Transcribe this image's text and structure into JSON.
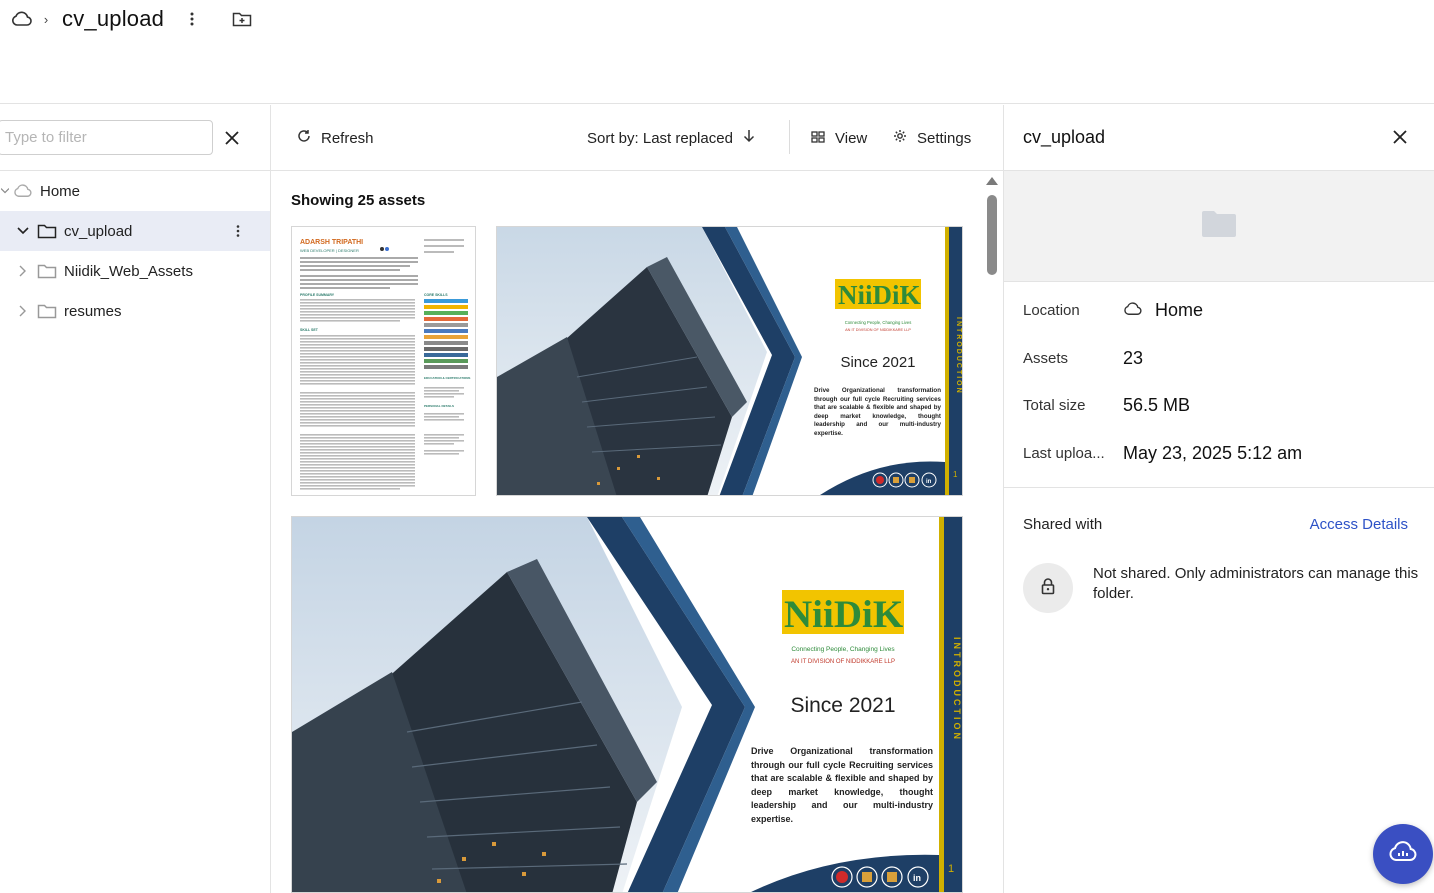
{
  "breadcrumb": {
    "root_icon": "cloud-icon",
    "current": "cv_upload"
  },
  "sidebar": {
    "filter_placeholder": "Type to filter",
    "items": [
      {
        "label": "Home",
        "icon": "cloud-icon",
        "expanded": true
      },
      {
        "label": "cv_upload",
        "icon": "folder-icon",
        "expanded": true,
        "selected": true
      },
      {
        "label": "Niidik_Web_Assets",
        "icon": "folder-icon",
        "expanded": false
      },
      {
        "label": "resumes",
        "icon": "folder-icon",
        "expanded": false
      }
    ]
  },
  "toolbar": {
    "refresh_label": "Refresh",
    "sort_label": "Sort by: Last replaced",
    "view_label": "View",
    "settings_label": "Settings"
  },
  "assets": {
    "showing": "Showing 25 assets",
    "resume": {
      "name": "ADARSH TRIPATHI",
      "subtitle": "WEB DEVELOPER | DESIGNER",
      "sections": [
        "PROFILE SUMMARY",
        "SKILL SET",
        "CORE SKILLS",
        "EDUCATION & CERTIFICATIONS",
        "PERSONAL DETAILS"
      ]
    },
    "brochure": {
      "brand": "NiiDiK",
      "tagline1": "Connecting People, Changing Lives",
      "tagline2": "AN IT DIVISION OF NIDDIKKARE LLP",
      "since": "Since 2021",
      "description": "Drive Organizational transformation through our full cycle Recruiting services that are scalable & flexible and shaped by deep market knowledge, thought leadership and our multi-industry expertise.",
      "side_label": "INTRODUCTION",
      "page_number": "1"
    }
  },
  "details": {
    "title": "cv_upload",
    "location_label": "Location",
    "location_value": "Home",
    "assets_label": "Assets",
    "assets_value": "23",
    "size_label": "Total size",
    "size_value": "56.5 MB",
    "upload_label": "Last uploa...",
    "upload_value": "May 23, 2025 5:12 am",
    "shared_label": "Shared with",
    "access_label": "Access Details",
    "not_shared": "Not shared. Only administrators can manage this folder."
  },
  "colors": {
    "accent": "#2d52c7",
    "fab": "#3a4fc2",
    "selected_row": "#e9ecf5",
    "brochure_navy": "#1e3f66",
    "brand_green": "#2e8b3a",
    "brand_yellow": "#f2c400"
  }
}
